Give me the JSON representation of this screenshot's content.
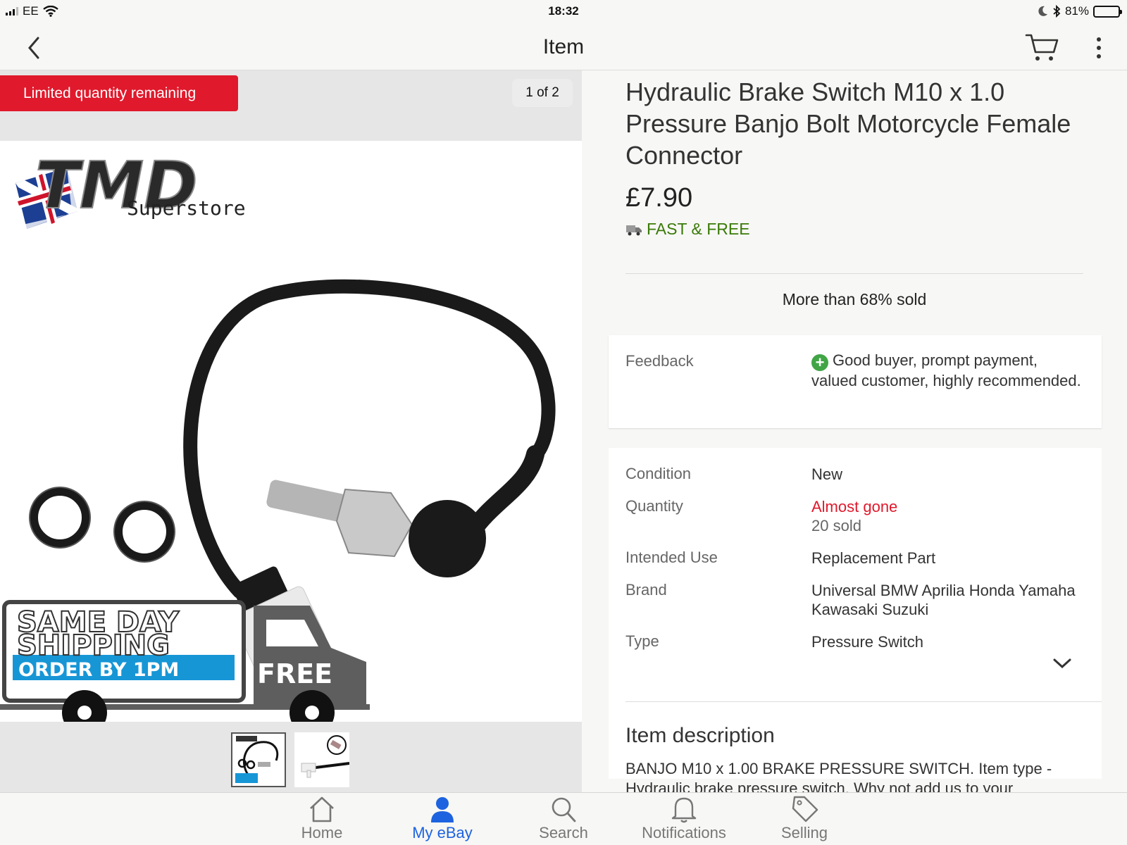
{
  "status_bar": {
    "carrier": "EE",
    "time": "18:32",
    "battery": "81%",
    "battery_level": 0.81
  },
  "nav": {
    "title": "Item",
    "icons": [
      "back-chevron-icon",
      "cart-icon",
      "more-vertical-icon"
    ]
  },
  "gallery": {
    "badge": "Limited quantity remaining",
    "counter": "1 of 2",
    "image": {
      "brand_logo_text": "TMD",
      "brand_sub": "Superstore",
      "banner_line1": "SAME DAY",
      "banner_line2": "SHIPPING",
      "banner_line3": "ORDER BY 1PM",
      "banner_free": "FREE"
    },
    "thumbnails": 2,
    "selected_thumbnail": 1
  },
  "item": {
    "title": "Hydraulic Brake Switch M10 x 1.0 Pressure Banjo Bolt Motorcycle Female Connector",
    "price": "£7.90",
    "shipping": "FAST & FREE",
    "sold_info": "More than 68% sold"
  },
  "feedback": {
    "label": "Feedback",
    "text": "Good buyer, prompt payment, valued customer, highly recommended."
  },
  "specs": {
    "condition_label": "Condition",
    "condition_value": "New",
    "quantity_label": "Quantity",
    "quantity_value": "Almost gone",
    "quantity_sold": "20 sold",
    "use_label": "Intended Use",
    "use_value": "Replacement Part",
    "brand_label": "Brand",
    "brand_value": "Universal BMW Aprilia Honda Yamaha Kawasaki Suzuki",
    "type_label": "Type",
    "type_value": "Pressure Switch"
  },
  "description": {
    "title": "Item description",
    "text": "BANJO M10 x 1.00 BRAKE PRESSURE SWITCH. Item type - Hydraulic brake pressure switch. Why not add us to your"
  },
  "tabs": [
    {
      "label": "Home",
      "icon": "home-icon"
    },
    {
      "label": "My eBay",
      "icon": "person-icon",
      "active": true
    },
    {
      "label": "Search",
      "icon": "search-icon"
    },
    {
      "label": "Notifications",
      "icon": "bell-icon"
    },
    {
      "label": "Selling",
      "icon": "tag-icon"
    }
  ],
  "colors": {
    "accent_blue": "#1d63e0",
    "badge_red": "#e0192c",
    "shipping_green": "#3a7a08"
  }
}
